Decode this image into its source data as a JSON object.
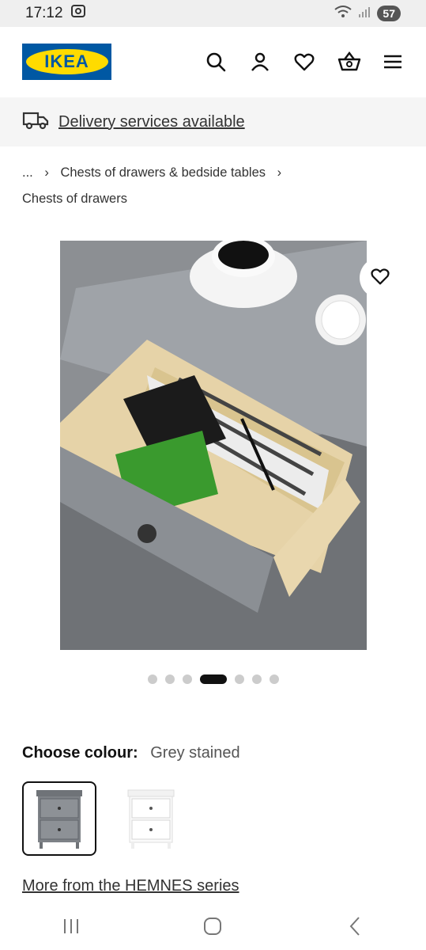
{
  "status_bar": {
    "time": "17:12",
    "battery": "57"
  },
  "header": {
    "logo_text": "IKEA",
    "icons": [
      "search-icon",
      "account-icon",
      "heart-icon",
      "basket-icon",
      "menu-icon"
    ]
  },
  "delivery": {
    "label": "Delivery services available"
  },
  "breadcrumb": {
    "ellipsis": "...",
    "parent": "Chests of drawers & bedside tables",
    "current": "Chests of drawers"
  },
  "gallery": {
    "image_count": 7,
    "active_index": 3
  },
  "colour": {
    "label": "Choose colour:",
    "value": "Grey stained",
    "options": [
      "Grey stained",
      "White"
    ]
  },
  "series_link": "More from the HEMNES series",
  "colors": {
    "ikea_blue": "#0058a3",
    "ikea_yellow": "#ffdb00"
  }
}
